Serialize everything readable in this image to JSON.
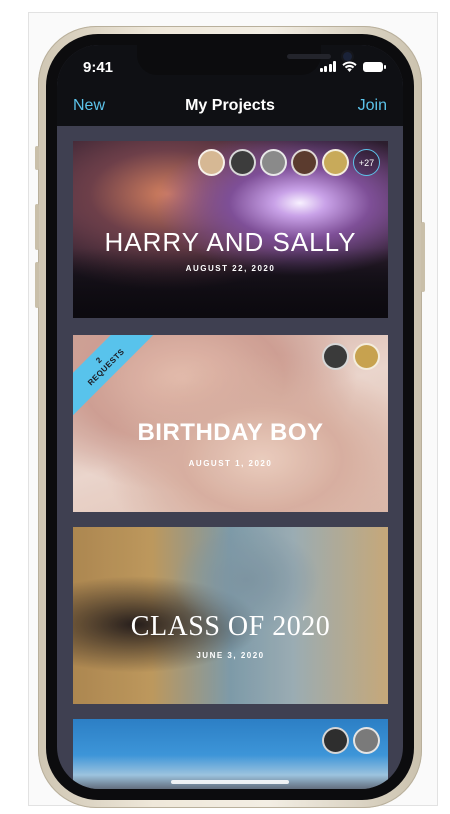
{
  "status_bar": {
    "time": "9:41"
  },
  "nav": {
    "left": "New",
    "title": "My Projects",
    "right": "Join"
  },
  "projects": [
    {
      "title": "HARRY AND SALLY",
      "date": "AUGUST 22, 2020",
      "extra_members": "+27"
    },
    {
      "title": "BIRTHDAY BOY",
      "date": "AUGUST 1, 2020",
      "requests_line1": "2",
      "requests_line2": "REQUESTS"
    },
    {
      "title": "CLASS OF 2020",
      "date": "JUNE 3, 2020"
    },
    {
      "title": "",
      "date": ""
    }
  ],
  "colors": {
    "accent": "#5cc3ea",
    "list_background": "#3f4051",
    "nav_background": "#0f1014"
  },
  "icons": [
    "signal-icon",
    "wifi-icon",
    "battery-icon",
    "avatar"
  ]
}
